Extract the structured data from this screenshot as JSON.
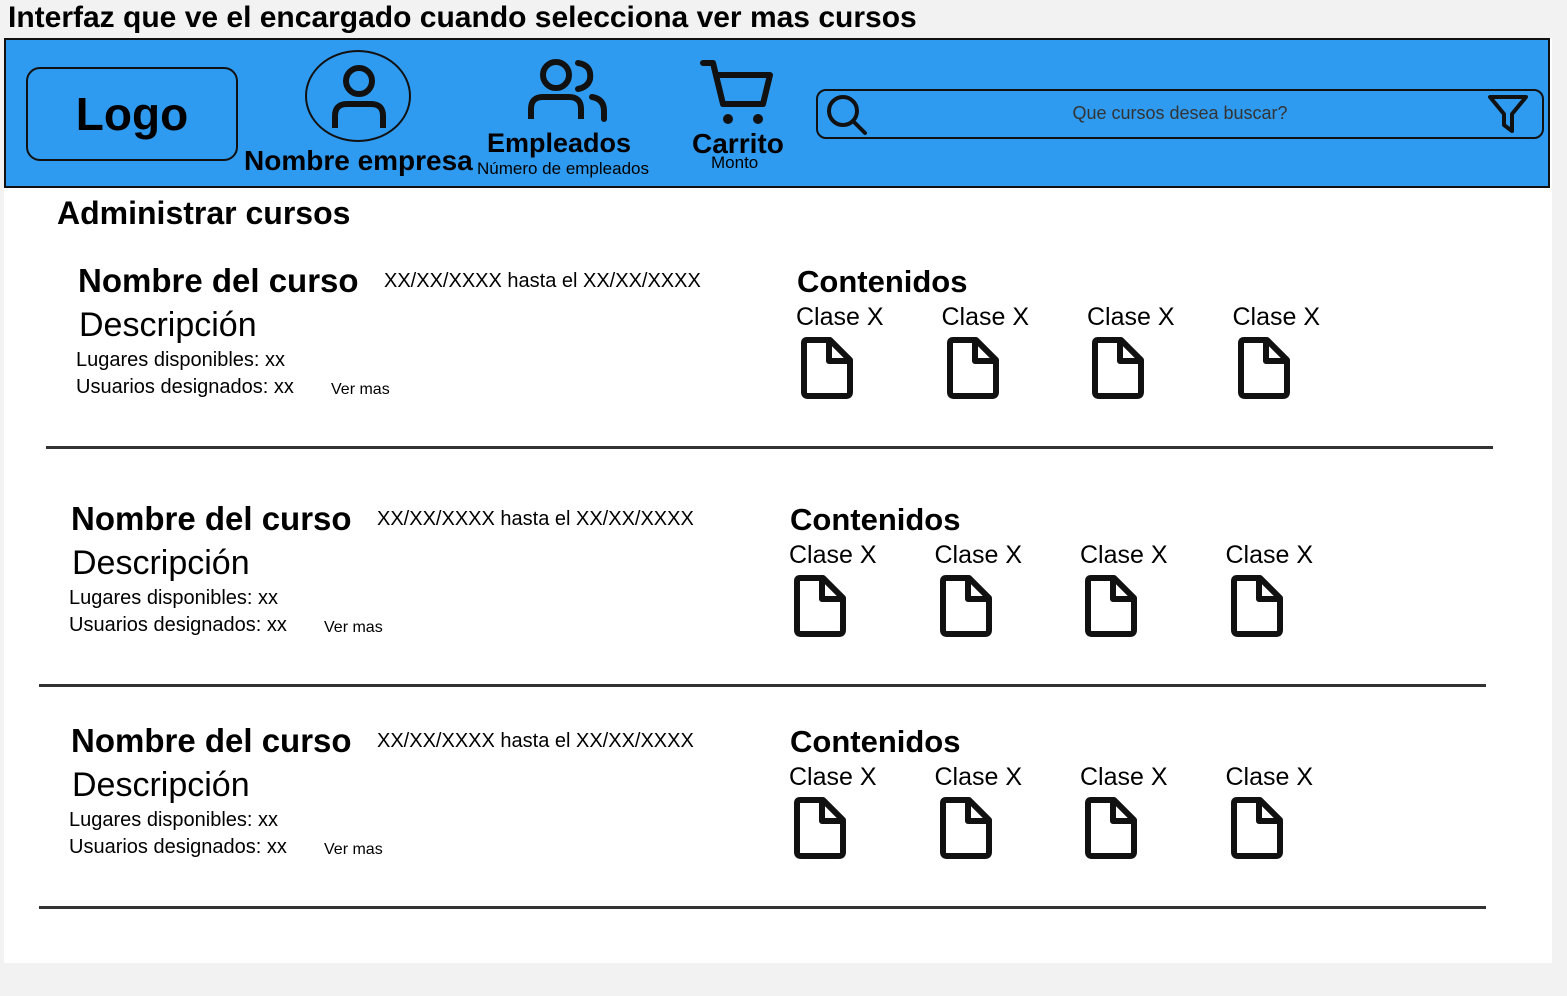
{
  "page_title": "Interfaz que ve el encargado cuando selecciona  ver mas cursos",
  "header": {
    "logo": "Logo",
    "company_name": "Nombre empresa",
    "employees_label": "Empleados",
    "employees_sub": "Número de empleados",
    "cart_label": "Carrito",
    "cart_sub": "Monto",
    "search_placeholder": "Que cursos desea buscar?",
    "icons": [
      "user-icon",
      "employees-icon",
      "cart-icon",
      "search-icon",
      "filter-icon"
    ],
    "accent_color": "#2f9bf0"
  },
  "section_title": "Administrar cursos",
  "courses": [
    {
      "name": "Nombre del curso",
      "dates": "XX/XX/XXXX hasta el XX/XX/XXXX",
      "description": "Descripción",
      "places": "Lugares disponibles: xx",
      "users": "Usuarios designados: xx",
      "more": "Ver mas",
      "contents_title": "Contenidos",
      "classes": [
        "Clase X",
        "Clase X",
        "Clase X",
        "Clase X"
      ]
    },
    {
      "name": "Nombre del curso",
      "dates": "XX/XX/XXXX hasta el XX/XX/XXXX",
      "description": "Descripción",
      "places": "Lugares disponibles: xx",
      "users": "Usuarios designados: xx",
      "more": "Ver mas",
      "contents_title": "Contenidos",
      "classes": [
        "Clase X",
        "Clase X",
        "Clase X",
        "Clase X"
      ]
    },
    {
      "name": "Nombre del curso",
      "dates": "XX/XX/XXXX hasta el XX/XX/XXXX",
      "description": "Descripción",
      "places": "Lugares disponibles: xx",
      "users": "Usuarios designados: xx",
      "more": "Ver mas",
      "contents_title": "Contenidos",
      "classes": [
        "Clase X",
        "Clase X",
        "Clase X",
        "Clase X"
      ]
    }
  ]
}
